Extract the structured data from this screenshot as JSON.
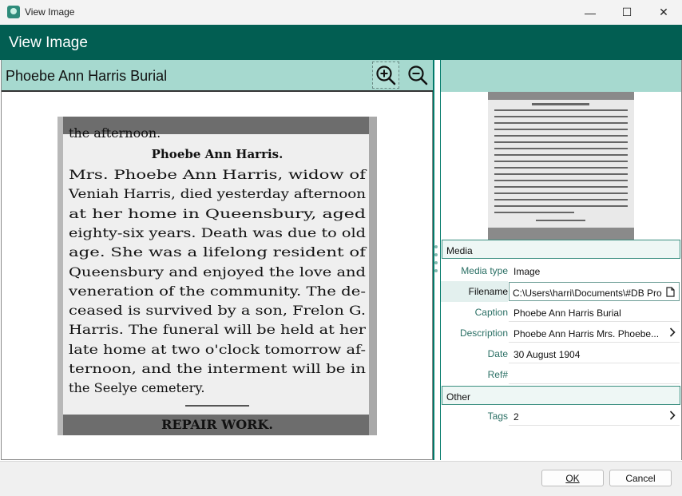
{
  "window": {
    "title": "View Image",
    "minimize_label": "—",
    "maximize_label": "☐",
    "close_label": "✕"
  },
  "header": {
    "title": "View Image"
  },
  "image": {
    "title": "Phoebe Ann Harris Burial",
    "icons": [
      "zoom-in-icon",
      "zoom-out-icon"
    ],
    "article": {
      "top_line": "the afternoon.",
      "headline": "Phoebe Ann Harris.",
      "lines": [
        "Mrs. Phoebe Ann Harris, widow of",
        "Veniah Harris, died yesterday afternoon",
        "at her home in Queensbury, aged",
        "eighty-six years. Death was due to old",
        "age. She was a lifelong resident of",
        "Queensbury and enjoyed the love and",
        "veneration of the community. The de-",
        "ceased is survived by a son, Frelon G.",
        "Harris. The funeral will be held at her",
        "late home at two o'clock tomorrow af-",
        "ternoon, and the interment will be in",
        "the Seelye cemetery."
      ],
      "bottom_headline": "REPAIR WORK."
    }
  },
  "sections": {
    "media": {
      "label": "Media",
      "rows": [
        {
          "label": "Media type",
          "value": "Image"
        },
        {
          "label": "Filename",
          "value": "C:\\Users\\harri\\Documents\\#DB Pro"
        },
        {
          "label": "Caption",
          "value": "Phoebe Ann Harris Burial"
        },
        {
          "label": "Description",
          "value": "Phoebe Ann Harris  Mrs. Phoebe..."
        },
        {
          "label": "Date",
          "value": "30 August 1904"
        },
        {
          "label": "Ref#",
          "value": ""
        }
      ]
    },
    "other": {
      "label": "Other",
      "rows": [
        {
          "label": "Tags",
          "value": "2"
        }
      ]
    }
  },
  "footer": {
    "ok_label": "OK",
    "cancel_label": "Cancel"
  },
  "colors": {
    "header": "#025e52",
    "panel_header": "#a6d9cf",
    "accent": "#027a6a"
  }
}
